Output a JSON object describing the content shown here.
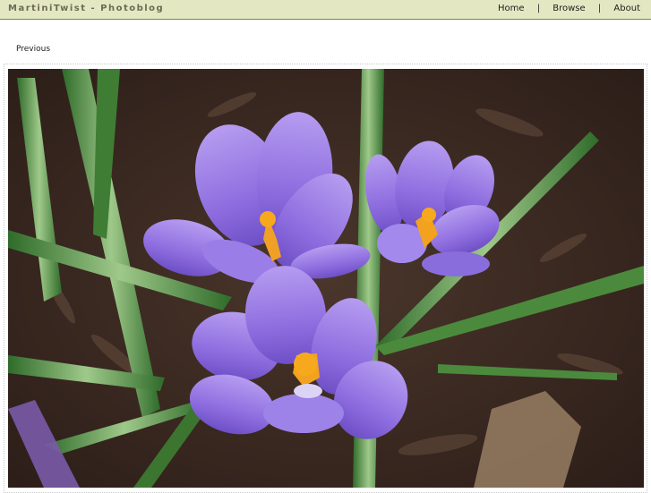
{
  "header": {
    "site_title": "MartiniTwist - Photoblog",
    "background_color": "#e3e8c2"
  },
  "nav": {
    "items": [
      {
        "label": "Home"
      },
      {
        "label": "Browse"
      },
      {
        "label": "About"
      }
    ],
    "separator": "|"
  },
  "pager": {
    "previous_label": "Previous"
  },
  "photo": {
    "subject": "purple-crocus-flowers"
  }
}
